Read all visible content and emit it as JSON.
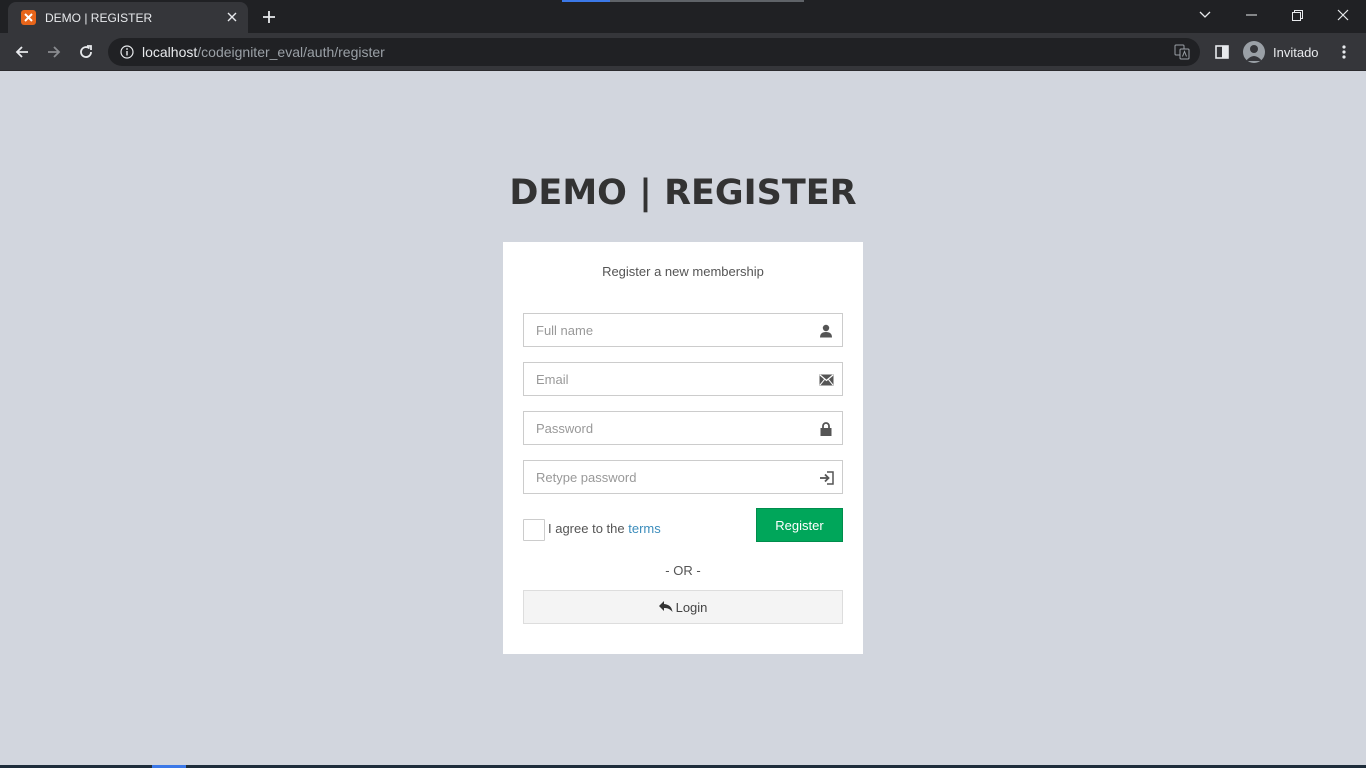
{
  "browser": {
    "tab": {
      "title": "DEMO | REGISTER",
      "favicon": "xampp-icon"
    },
    "url": {
      "host": "localhost",
      "path": "/codeigniter_eval/auth/register"
    },
    "profile_name": "Invitado"
  },
  "page": {
    "logo": "DEMO | REGISTER",
    "box_msg": "Register a new membership",
    "fields": {
      "full_name": {
        "placeholder": "Full name",
        "value": ""
      },
      "email": {
        "placeholder": "Email",
        "value": ""
      },
      "password": {
        "placeholder": "Password",
        "value": ""
      },
      "retype_password": {
        "placeholder": "Retype password",
        "value": ""
      }
    },
    "agree_text": "I agree to the ",
    "terms_link": "terms",
    "register_label": "Register",
    "or_text": "- OR -",
    "login_label": "Login"
  },
  "colors": {
    "page_bg": "#d2d6de",
    "register_btn": "#00a65a",
    "link": "#3c8dbc"
  }
}
